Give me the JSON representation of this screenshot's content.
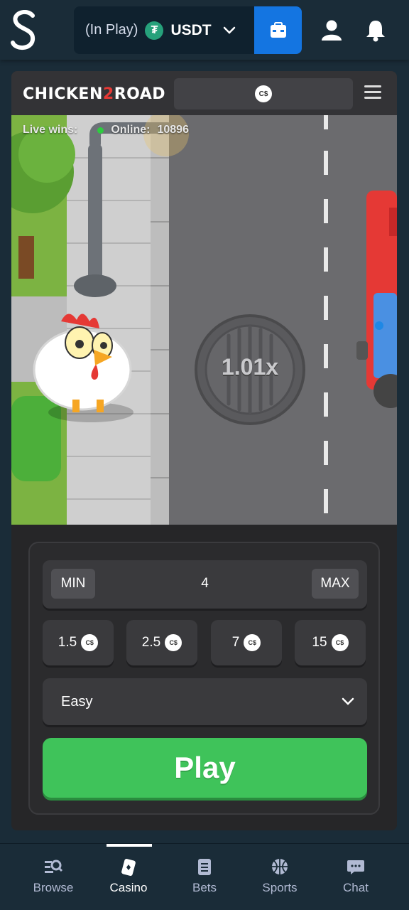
{
  "header": {
    "wallet_status": "(In Play)",
    "currency": "USDT",
    "currency_icon": "tether-icon",
    "accent_color": "#1475e1"
  },
  "game": {
    "brand_left": "CHICKEN",
    "brand_mid": "2",
    "brand_right": "ROAD",
    "head_badge": "C$",
    "live_wins_label": "Live wins:",
    "online_label": "Online:",
    "online_count": "10896",
    "multiplier": "1.01x"
  },
  "controls": {
    "min_label": "MIN",
    "max_label": "MAX",
    "amount_value": "4",
    "chips": [
      {
        "value": "1.5",
        "badge": "C$"
      },
      {
        "value": "2.5",
        "badge": "C$"
      },
      {
        "value": "7",
        "badge": "C$"
      },
      {
        "value": "15",
        "badge": "C$"
      }
    ],
    "difficulty": "Easy",
    "play_label": "Play",
    "play_color": "#3fc35a"
  },
  "nav": {
    "items": [
      {
        "label": "Browse",
        "icon": "browse-icon"
      },
      {
        "label": "Casino",
        "icon": "casino-icon",
        "active": true
      },
      {
        "label": "Bets",
        "icon": "bets-icon"
      },
      {
        "label": "Sports",
        "icon": "sports-icon"
      },
      {
        "label": "Chat",
        "icon": "chat-icon"
      }
    ]
  }
}
